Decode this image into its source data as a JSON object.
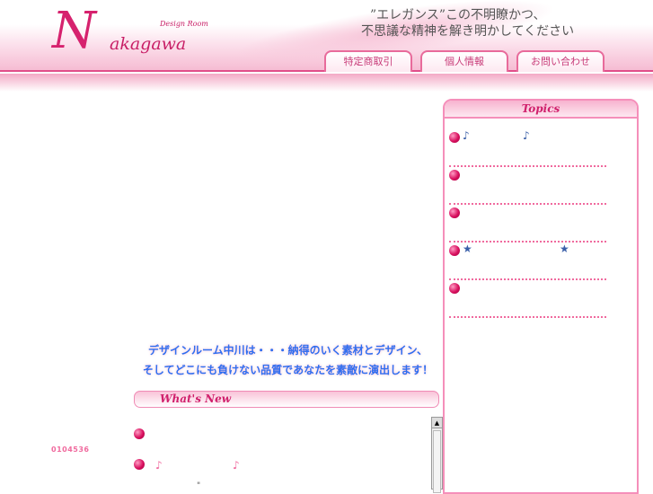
{
  "header": {
    "logo_text": "Nakagawa",
    "logo_initial": "N",
    "logo_word": "akagawa",
    "logo_sub": "Design Room",
    "tagline_1": "”エレガンス”この不明瞭かつ、",
    "tagline_2": "不思議な精神を解き明かしてください"
  },
  "nav": [
    {
      "label": "特定商取引"
    },
    {
      "label": "個人情報"
    },
    {
      "label": "お問い合わせ"
    }
  ],
  "topics": {
    "title": "Topics",
    "items": [
      {
        "sym_left": "♪",
        "sym_right": "♪"
      },
      {},
      {},
      {
        "sym_left": "★",
        "sym_right": "★"
      },
      {}
    ]
  },
  "slogan": {
    "line1": "デザインルーム中川は・・・納得のいく素材とデザイン、",
    "line2": "そしてどこにも負けない品質であなたを素敵に演出します！"
  },
  "whats_new": {
    "title": "What's New",
    "items": [
      {},
      {
        "sym_left": "♪",
        "sym_right": "♪"
      }
    ],
    "fragment": "\""
  },
  "counter": "0104536"
}
